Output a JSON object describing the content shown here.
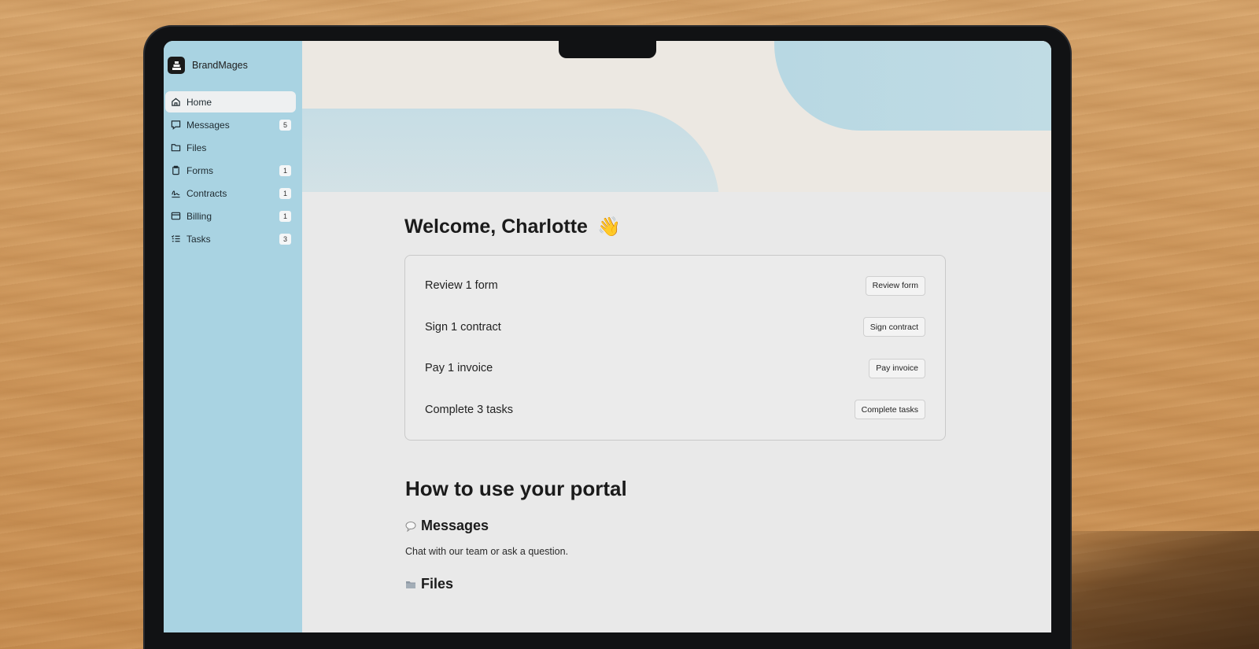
{
  "brand": {
    "name": "BrandMages"
  },
  "sidebar": {
    "items": [
      {
        "label": "Home",
        "icon": "home-icon",
        "badge": null,
        "active": true
      },
      {
        "label": "Messages",
        "icon": "message-icon",
        "badge": "5"
      },
      {
        "label": "Files",
        "icon": "folder-icon",
        "badge": null
      },
      {
        "label": "Forms",
        "icon": "clipboard-icon",
        "badge": "1"
      },
      {
        "label": "Contracts",
        "icon": "signature-icon",
        "badge": "1"
      },
      {
        "label": "Billing",
        "icon": "billing-icon",
        "badge": "1"
      },
      {
        "label": "Tasks",
        "icon": "tasks-icon",
        "badge": "3"
      }
    ]
  },
  "main": {
    "welcome": "Welcome, Charlotte",
    "welcome_emoji": "👋",
    "tasks": [
      {
        "text": "Review 1 form",
        "button": "Review form"
      },
      {
        "text": "Sign 1 contract",
        "button": "Sign contract"
      },
      {
        "text": "Pay 1 invoice",
        "button": "Pay invoice"
      },
      {
        "text": "Complete 3 tasks",
        "button": "Complete tasks"
      }
    ],
    "howto_title": "How to use your portal",
    "sections": [
      {
        "title": "Messages",
        "icon": "speech-bubble-icon",
        "desc": "Chat with our team or ask a question."
      },
      {
        "title": "Files",
        "icon": "file-folder-icon",
        "desc": ""
      }
    ]
  },
  "colors": {
    "sidebar": "#a9d3e2",
    "accent_blue": "#b8d8e3",
    "wood": "#d19a5e"
  }
}
